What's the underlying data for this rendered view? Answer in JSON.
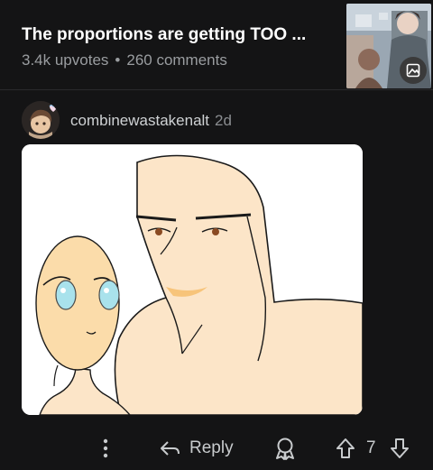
{
  "post": {
    "title": "The proportions are getting TOO ...",
    "upvotes": "3.4k upvotes",
    "separator": "•",
    "comments": "260 comments"
  },
  "comment": {
    "author": "combinewastakenalt",
    "age": "2d"
  },
  "actions": {
    "reply_label": "Reply",
    "vote_count": "7"
  },
  "icons": {
    "more": "more-vertical-icon",
    "reply": "reply-arrow-icon",
    "award": "award-icon",
    "upvote": "upvote-arrow-icon",
    "downvote": "downvote-arrow-icon",
    "gallery": "gallery-icon"
  },
  "colors": {
    "background": "#141415",
    "title": "#ffffff",
    "meta": "#9a9da0",
    "skin": "#fce5c8",
    "eyes": "#a9e2ec"
  }
}
